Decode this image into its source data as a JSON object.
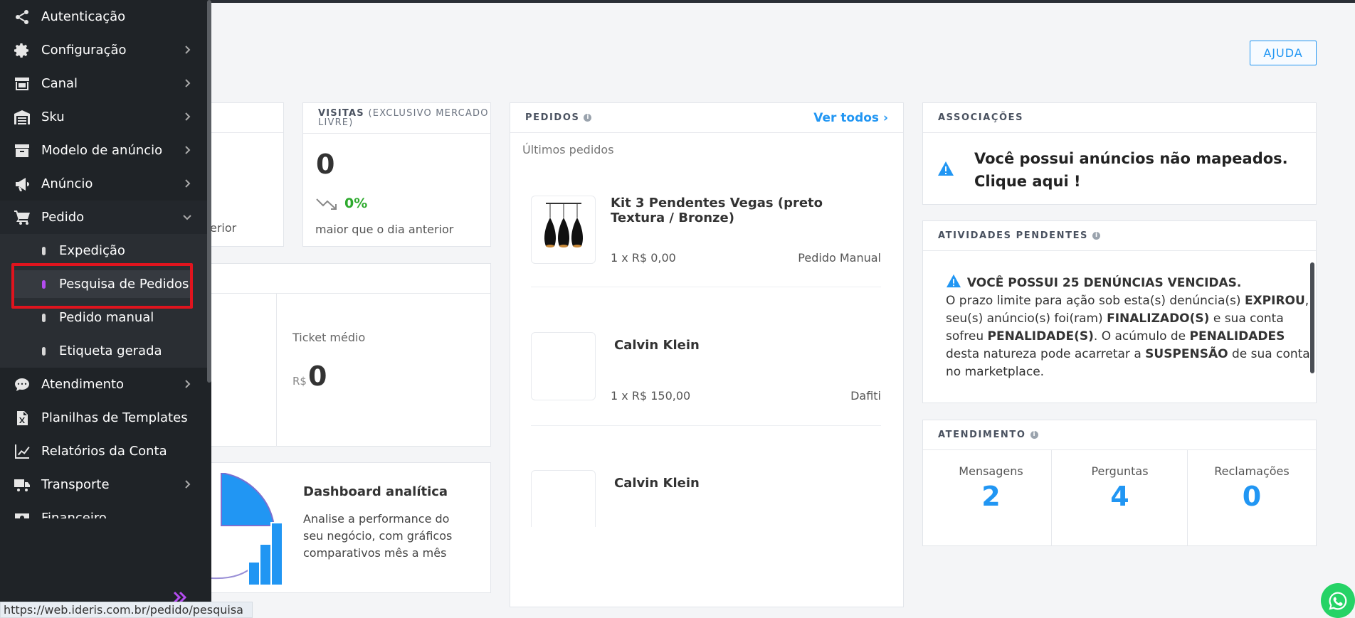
{
  "sidebar": {
    "items": [
      {
        "label": "Autenticação",
        "icon": "share-icon"
      },
      {
        "label": "Configuração",
        "icon": "gear-icon"
      },
      {
        "label": "Canal",
        "icon": "store-icon"
      },
      {
        "label": "Sku",
        "icon": "warehouse-icon"
      },
      {
        "label": "Modelo de anúncio",
        "icon": "archive-icon"
      },
      {
        "label": "Anúncio",
        "icon": "megaphone-icon"
      },
      {
        "label": "Pedido",
        "icon": "cart-icon"
      },
      {
        "label": "Atendimento",
        "icon": "chat-icon"
      },
      {
        "label": "Planilhas de Templates",
        "icon": "excel-file-icon"
      },
      {
        "label": "Relatórios da Conta",
        "icon": "line-chart-icon"
      },
      {
        "label": "Transporte",
        "icon": "truck-icon"
      },
      {
        "label": "Financeiro",
        "icon": "money-icon"
      }
    ],
    "pedido_sub": [
      {
        "label": "Expedição"
      },
      {
        "label": "Pesquisa de Pedidos"
      },
      {
        "label": "Pedido manual"
      },
      {
        "label": "Etiqueta gerada"
      }
    ]
  },
  "status_url": "https://web.ideris.com.br/pedido/pesquisa",
  "help_label": "AJUDA",
  "vendas_partial": {
    "text": "erior"
  },
  "visitas": {
    "title": "VISITAS",
    "subtitle": "(EXCLUSIVO MERCADO LIVRE)",
    "value": "0",
    "pct": "0%",
    "compare": "maior que o dia anterior"
  },
  "ticket": {
    "label": "Ticket médio",
    "currency": "R$",
    "value": "0"
  },
  "dashboard": {
    "title": "Dashboard analítica",
    "description": "Analise a performance do seu negócio, com gráficos comparativos mês a mês"
  },
  "pedidos": {
    "title": "PEDIDOS",
    "see_all": "Ver todos",
    "subtitle": "Últimos pedidos",
    "orders": [
      {
        "name": "Kit 3 Pendentes Vegas (preto Textura / Bronze)",
        "qty": "1 x R$ 0,00",
        "source": "Pedido Manual"
      },
      {
        "name": "Calvin Klein",
        "qty": "1 x R$ 150,00",
        "source": "Dafiti"
      },
      {
        "name": "Calvin Klein",
        "qty": "",
        "source": ""
      }
    ]
  },
  "associacoes": {
    "title": "ASSOCIAÇÕES",
    "line1": "Você possui anúncios não mapeados.",
    "line2": "Clique aqui !"
  },
  "atividades": {
    "title": "ATIVIDADES PENDENTES",
    "headline": "VOCÊ POSSUI 25 DENÚNCIAS VENCIDAS.",
    "t1": "O prazo limite para ação sob esta(s) denúncia(s) ",
    "b1": "EXPIROU",
    "t2": ", seu(s) anúncio(s) foi(ram) ",
    "b2": "FINALIZADO(S)",
    "t3": " e sua conta sofreu ",
    "b3": "PENALIDADE(S)",
    "t4": ". O acúmulo de ",
    "b4": "PENALIDADES",
    "t5": " desta natureza pode acarretar a ",
    "b5": "SUSPENSÃO",
    "t6": " de sua conta no marketplace."
  },
  "atendimento": {
    "title": "ATENDIMENTO",
    "cols": [
      {
        "label": "Mensagens",
        "value": "2"
      },
      {
        "label": "Perguntas",
        "value": "4"
      },
      {
        "label": "Reclamações",
        "value": "0"
      }
    ]
  },
  "colors": {
    "accent": "#2196f3",
    "sidebar_bg": "#1f2327",
    "active_dot": "#b44cf0",
    "highlight": "#e0141e",
    "positive": "#2eaa2e"
  }
}
